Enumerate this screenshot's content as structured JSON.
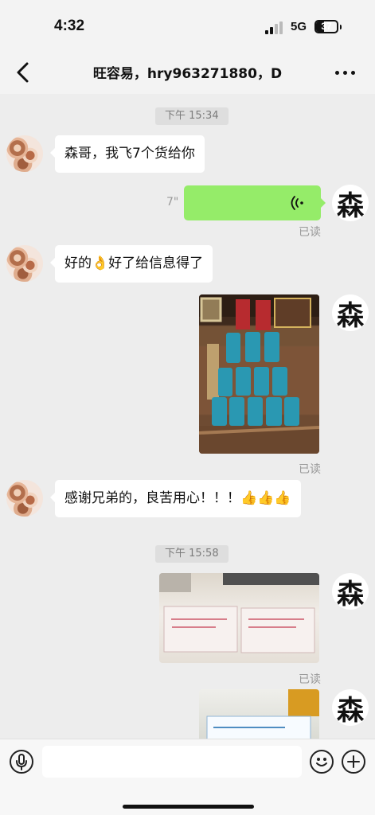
{
  "status_bar": {
    "time": "4:32",
    "network": "5G",
    "battery_percent": 37,
    "battery_label": "37"
  },
  "nav": {
    "title": "旺容易，hry963271880，D"
  },
  "messages": {
    "timestamp_1": "下午 15:34",
    "msg_1": "森哥，我飞7个货给你",
    "voice_duration": "7\"",
    "read_1": "已读",
    "msg_2_pre": "好的",
    "msg_2_post": "好了给信息得了",
    "read_2": "已读",
    "msg_3_text": "感谢兄弟的，良苦用心！！！",
    "msg_3_emojis": "👍👍👍",
    "timestamp_2": "下午 15:58",
    "read_3": "已读"
  },
  "avatar": {
    "self_char": "森"
  },
  "composer": {
    "placeholder": ""
  },
  "icons": {
    "back": "back-arrow-icon",
    "more": "more-dots-icon",
    "voice": "voice-icon",
    "emoji": "emoji-icon",
    "plus": "plus-icon",
    "scroll": "chevron-down-icon"
  }
}
